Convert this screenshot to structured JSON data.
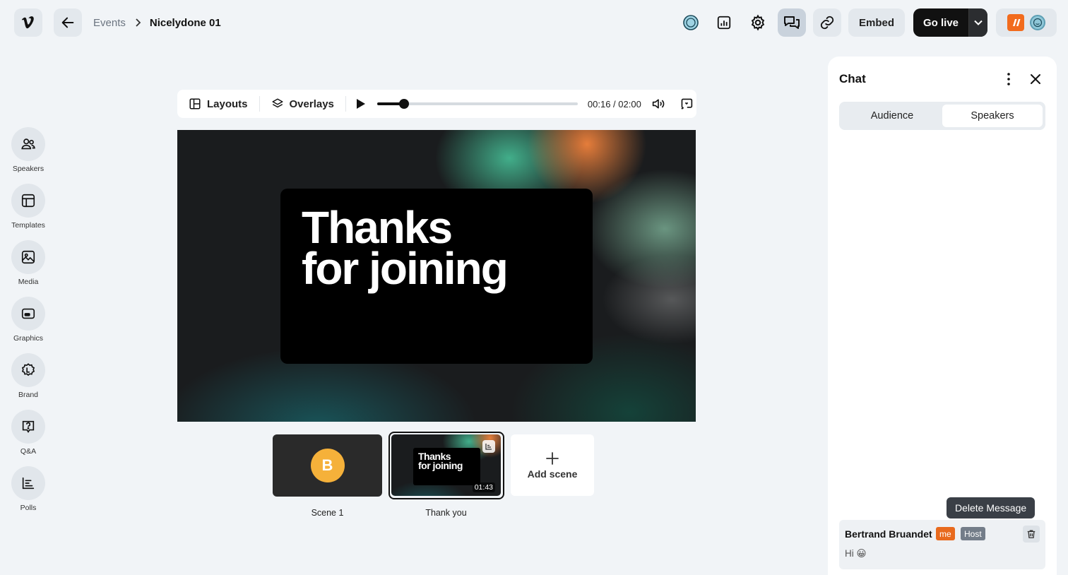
{
  "breadcrumb": {
    "parent": "Events",
    "current": "Nicelydone 01"
  },
  "toolbar": {
    "embed_label": "Embed",
    "golive_label": "Go live"
  },
  "rail": {
    "items": [
      {
        "label": "Speakers",
        "icon": "users-icon"
      },
      {
        "label": "Templates",
        "icon": "layout-icon"
      },
      {
        "label": "Media",
        "icon": "image-icon"
      },
      {
        "label": "Graphics",
        "icon": "graphics-icon"
      },
      {
        "label": "Brand",
        "icon": "brand-icon"
      },
      {
        "label": "Q&A",
        "icon": "question-icon"
      },
      {
        "label": "Polls",
        "icon": "bar-chart-icon"
      }
    ]
  },
  "player": {
    "layouts_label": "Layouts",
    "overlays_label": "Overlays",
    "time": "00:16 / 02:00",
    "progress": 0.135
  },
  "stage": {
    "line1": "Thanks",
    "line2": "for joining"
  },
  "scenes": [
    {
      "label": "Scene 1",
      "avatar_letter": "B"
    },
    {
      "label": "Thank you",
      "mini_line1": "Thanks",
      "mini_line2": "for joining",
      "duration": "01:43"
    }
  ],
  "add_scene_label": "Add scene",
  "chat": {
    "title": "Chat",
    "tabs": [
      {
        "label": "Audience",
        "active": false
      },
      {
        "label": "Speakers",
        "active": true
      }
    ],
    "tooltip": "Delete Message",
    "message": {
      "author": "Bertrand Bruandet",
      "badge_me": "me",
      "badge_host": "Host",
      "text": "Hi 😀"
    }
  },
  "colors": {
    "accent_orange": "#e86a1e",
    "golive_bg": "#111111",
    "avatar_yellow": "#f5b13a"
  }
}
